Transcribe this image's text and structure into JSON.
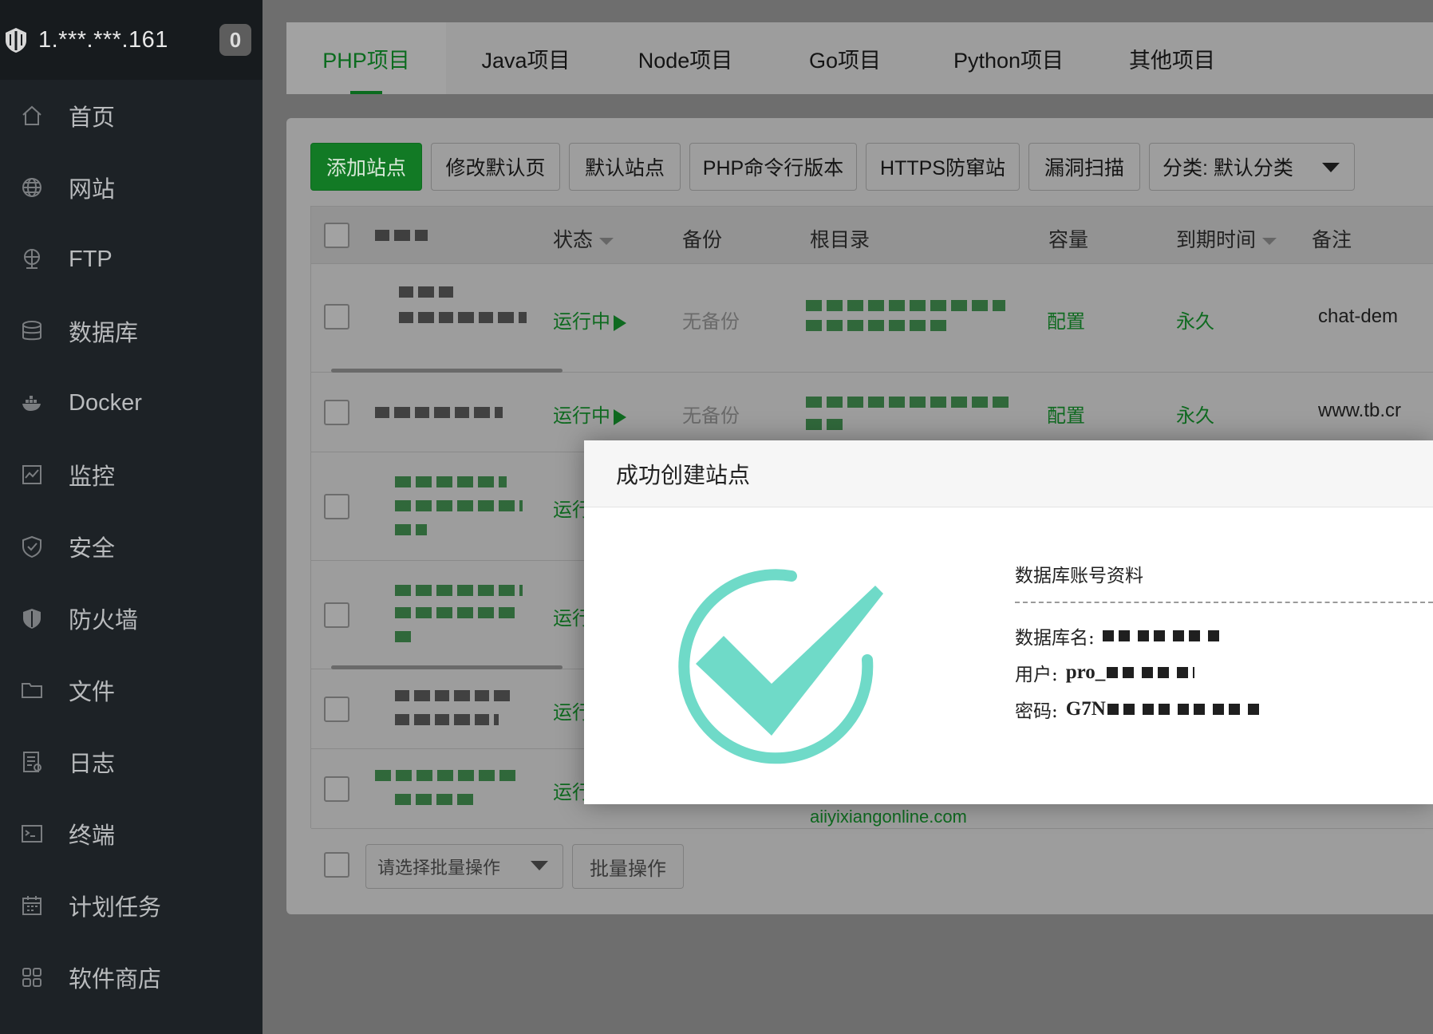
{
  "server": {
    "ip": "1.***.***.161",
    "badge": "0"
  },
  "sidebar": {
    "items": [
      {
        "label": "首页",
        "icon": "home-icon"
      },
      {
        "label": "网站",
        "icon": "globe-icon"
      },
      {
        "label": "FTP",
        "icon": "ftp-icon"
      },
      {
        "label": "数据库",
        "icon": "database-icon"
      },
      {
        "label": "Docker",
        "icon": "docker-icon"
      },
      {
        "label": "监控",
        "icon": "monitor-icon"
      },
      {
        "label": "安全",
        "icon": "shield-icon"
      },
      {
        "label": "防火墙",
        "icon": "firewall-icon"
      },
      {
        "label": "文件",
        "icon": "folder-icon"
      },
      {
        "label": "日志",
        "icon": "log-icon"
      },
      {
        "label": "终端",
        "icon": "terminal-icon"
      },
      {
        "label": "计划任务",
        "icon": "calendar-icon"
      },
      {
        "label": "软件商店",
        "icon": "apps-icon"
      }
    ]
  },
  "tabs": [
    "PHP项目",
    "Java项目",
    "Node项目",
    "Go项目",
    "Python项目",
    "其他项目"
  ],
  "toolbar": {
    "add_site": "添加站点",
    "edit_default_page": "修改默认页",
    "default_site": "默认站点",
    "php_cli_version": "PHP命令行版本",
    "https_anti_tamper": "HTTPS防窜站",
    "vuln_scan": "漏洞扫描",
    "category": "分类: 默认分类"
  },
  "table": {
    "headers": {
      "status": "状态",
      "backup": "备份",
      "root": "根目录",
      "capacity": "容量",
      "expire": "到期时间",
      "remark": "备注"
    },
    "rows": [
      {
        "status": "运行中",
        "backup": "无备份",
        "capacity": "配置",
        "expire": "永久",
        "remark": "chat-dem"
      },
      {
        "status": "运行中",
        "backup": "无备份",
        "capacity": "配置",
        "expire": "永久",
        "remark": "www.tb.cr"
      },
      {
        "status": "运行"
      },
      {
        "status": "运行"
      },
      {
        "status": "运行"
      },
      {
        "status": "运行"
      }
    ],
    "partial_root_text": "aiiyixiangonline.com"
  },
  "footer": {
    "batch_placeholder": "请选择批量操作",
    "batch_button": "批量操作"
  },
  "modal": {
    "title": "成功创建站点",
    "db_section_title": "数据库账号资料",
    "db_name_label": "数据库名:",
    "user_label": "用户:",
    "user_value_visible": "pro_",
    "password_label": "密码:",
    "password_value_visible": "G7N"
  },
  "colors": {
    "accent": "#20a53a",
    "check": "#6fdac8",
    "sidebar_bg": "#1d2226"
  }
}
